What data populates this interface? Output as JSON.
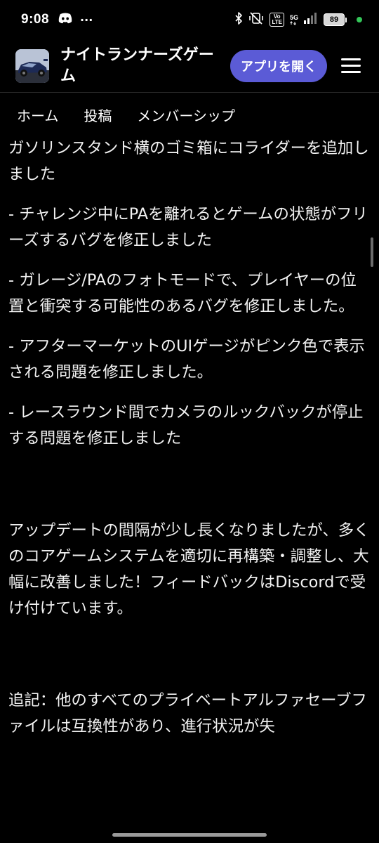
{
  "status_bar": {
    "time": "9:08",
    "dots": "···",
    "volte_top": "Vo",
    "volte_bottom": "LTE",
    "network": "5G",
    "battery": "89"
  },
  "header": {
    "title": "ナイトランナーズゲーム",
    "open_app_button": "アプリを開く"
  },
  "tabs": [
    "ホーム",
    "投稿",
    "メンバーシップ"
  ],
  "content": {
    "paragraphs": [
      "ガソリンスタンド横のゴミ箱にコライダーを追加しました",
      "- チャレンジ中にPAを離れるとゲームの状態がフリーズするバグを修正しました",
      "- ガレージ/PAのフォトモードで、プレイヤーの位置と衝突する可能性のあるバグを修正しました。",
      "- アフターマーケットのUIゲージがピンク色で表示される問題を修正しました。",
      "- レースラウンド間でカメラのルックバックが停止する問題を修正しました",
      "アップデートの間隔が少し長くなりましたが、多くのコアゲームシステムを適切に再構築・調整し、大幅に改善しました！フィードバックはDiscordで受け付けています。",
      "追記：他のすべてのプライベートアルファセーブファイルは互換性があり、進行状況が失"
    ]
  },
  "colors": {
    "background": "#000000",
    "accent_button": "#5b5bd6",
    "text": "#f2f2f2"
  }
}
